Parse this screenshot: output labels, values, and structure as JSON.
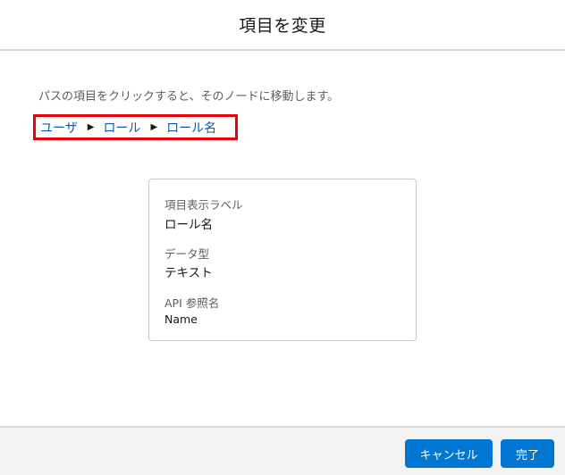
{
  "modal": {
    "title": "項目を変更"
  },
  "instruction": "パスの項目をクリックすると、そのノードに移動します。",
  "breadcrumb": {
    "items": [
      "ユーザ",
      "ロール",
      "ロール名"
    ],
    "separator_icon": "right-triangle-icon",
    "highlight_color": "#e8000b"
  },
  "field_details": {
    "label_title": "項目表示ラベル",
    "label_value": "ロール名",
    "type_title": "データ型",
    "type_value": "テキスト",
    "api_title": "API 参照名",
    "api_value": "Name"
  },
  "footer": {
    "cancel_label": "キャンセル",
    "done_label": "完了",
    "button_color": "#0176d3"
  }
}
